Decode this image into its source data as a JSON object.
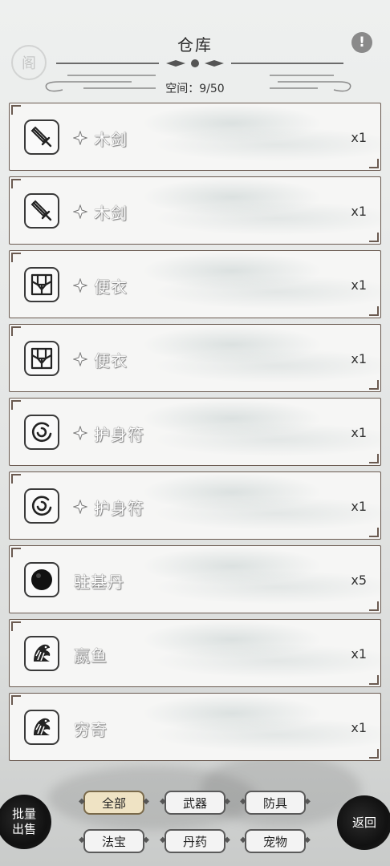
{
  "header": {
    "title": "仓库",
    "space_label": "空间：9/50",
    "info_icon": "exclamation-icon"
  },
  "background": {
    "seal_char": "阁"
  },
  "items": [
    {
      "icon": "sword-icon",
      "starred": true,
      "name": "木剑",
      "qty": "x1"
    },
    {
      "icon": "sword-icon",
      "starred": true,
      "name": "木剑",
      "qty": "x1"
    },
    {
      "icon": "robe-icon",
      "starred": true,
      "name": "便衣",
      "qty": "x1"
    },
    {
      "icon": "robe-icon",
      "starred": true,
      "name": "便衣",
      "qty": "x1"
    },
    {
      "icon": "talisman-icon",
      "starred": true,
      "name": "护身符",
      "qty": "x1"
    },
    {
      "icon": "talisman-icon",
      "starred": true,
      "name": "护身符",
      "qty": "x1"
    },
    {
      "icon": "pill-icon",
      "starred": false,
      "name": "驻基丹",
      "qty": "x5"
    },
    {
      "icon": "beast-icon",
      "starred": false,
      "name": "嬴鱼",
      "qty": "x1"
    },
    {
      "icon": "beast-icon",
      "starred": false,
      "name": "穷奇",
      "qty": "x1"
    }
  ],
  "bottom": {
    "batch_sell_line1": "批量",
    "batch_sell_line2": "出售",
    "back_label": "返回",
    "filters": [
      {
        "label": "全部",
        "active": true
      },
      {
        "label": "武器",
        "active": false
      },
      {
        "label": "防具",
        "active": false
      },
      {
        "label": "法宝",
        "active": false
      },
      {
        "label": "丹药",
        "active": false
      },
      {
        "label": "宠物",
        "active": false
      }
    ]
  },
  "colors": {
    "accent": "#efe3c4",
    "frame": "#6a5a50",
    "dark_button": "#111111"
  }
}
